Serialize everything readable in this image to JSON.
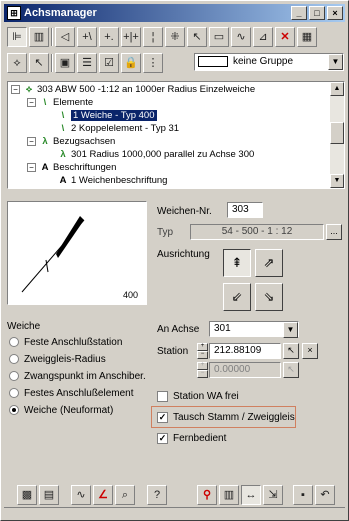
{
  "window": {
    "title": "Achsmanager",
    "controls": [
      "_",
      "□",
      "×"
    ]
  },
  "toolbar1": [
    "tree-view-icon",
    "table-view-icon",
    "draw-axis-icon",
    "add-node-icon",
    "add-element-icon",
    "insert-icon",
    "split-icon",
    "delete-grey-icon",
    "snap-icon",
    "measure-icon",
    "tangent-icon",
    "delete-red-icon",
    "options-dropdown-icon"
  ],
  "toolbar2": [
    "select-icon",
    "pointer-icon",
    "edit-icon",
    "list-icon",
    "check-icon",
    "lock-icon",
    "layer-icon"
  ],
  "group_combo": {
    "value": "keine Gruppe"
  },
  "tree": {
    "root": "303 ABW 500 -1:12 an 1000er Radius Einzelweiche",
    "elemente": "Elemente",
    "item1": "1 Weiche - Typ 400",
    "item2": "2 Koppelelement - Typ 31",
    "bezugsachsen": "Bezugsachsen",
    "bezug1": "301 Radius 1000,000 parallel zu Achse 300",
    "beschriftungen": "Beschriftungen",
    "beschr1": "1 Weichenbeschriftung"
  },
  "preview": {
    "scale_label": "400"
  },
  "form": {
    "weichen_nr_label": "Weichen-Nr.",
    "weichen_nr": "303",
    "typ_label": "Typ",
    "typ_value": "54 - 500 - 1 : 12",
    "typ_btn": "...",
    "ausrichtung_label": "Ausrichtung",
    "an_achse_label": "An Achse",
    "an_achse": "301",
    "station_label": "Station",
    "station": "212.88109",
    "station2": "0.00000"
  },
  "weiche": {
    "label": "Weiche",
    "options": [
      {
        "label": "Feste Anschlußstation",
        "selected": false
      },
      {
        "label": "Zweiggleis-Radius",
        "selected": false
      },
      {
        "label": "Zwangspunkt im Anschiber.",
        "selected": false
      },
      {
        "label": "Festes Anschlußelement",
        "selected": false
      },
      {
        "label": "Weiche (Neuformat)",
        "selected": true
      }
    ]
  },
  "checks": {
    "station_wa": {
      "label": "Station WA frei",
      "checked": false
    },
    "tausch": {
      "label": "Tausch Stamm / Zweiggleis",
      "checked": true
    },
    "fernbedient": {
      "label": "Fernbedient",
      "checked": true
    }
  },
  "bottom_toolbar": [
    "grid-icon",
    "sheet-icon",
    "curve-icon",
    "angle-icon",
    "zoom-icon",
    "help-icon",
    "axis-mark-icon",
    "table-icon",
    "stretch-icon",
    "export-icon",
    "save-icon",
    "undo-icon"
  ]
}
